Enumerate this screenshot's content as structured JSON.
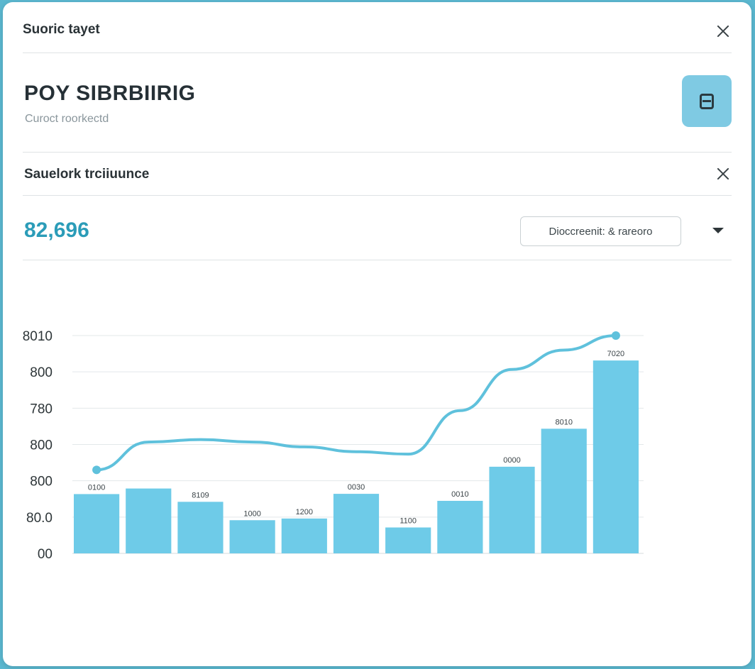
{
  "dialog": {
    "header_title": "Suoric tayet",
    "page_title": "POY SIBRBIIRIG",
    "page_subtitle": "Curoct roorkectd",
    "section_title": "Sauelork trciiuunce",
    "metric_value": "82,696",
    "select_value": "Dioccreenit: & rareoro",
    "icons": {
      "close": "close-icon",
      "action": "save-icon",
      "dropdown": "chevron-down-icon"
    }
  },
  "colors": {
    "accent": "#2b9cb8",
    "bar": "#6ecbe8",
    "line": "#5fc1dc",
    "backdrop": "#5bb8d0"
  },
  "chart_data": {
    "type": "bar",
    "y_ticks": [
      "00",
      "80.0",
      "800",
      "800",
      "780",
      "800",
      "8010"
    ],
    "ylim": [
      0,
      900
    ],
    "bars": [
      {
        "value": 245,
        "label": "0100"
      },
      {
        "value": 268,
        "label": ""
      },
      {
        "value": 213,
        "label": "8109"
      },
      {
        "value": 137,
        "label": "1000"
      },
      {
        "value": 144,
        "label": "1200"
      },
      {
        "value": 246,
        "label": "0030"
      },
      {
        "value": 107,
        "label": "1100"
      },
      {
        "value": 217,
        "label": "0010"
      },
      {
        "value": 358,
        "label": "0000"
      },
      {
        "value": 515,
        "label": "8010"
      },
      {
        "value": 797,
        "label": "7020"
      }
    ],
    "line": [
      345,
      460,
      470,
      460,
      440,
      420,
      410,
      590,
      760,
      840,
      900
    ],
    "grid": true
  }
}
